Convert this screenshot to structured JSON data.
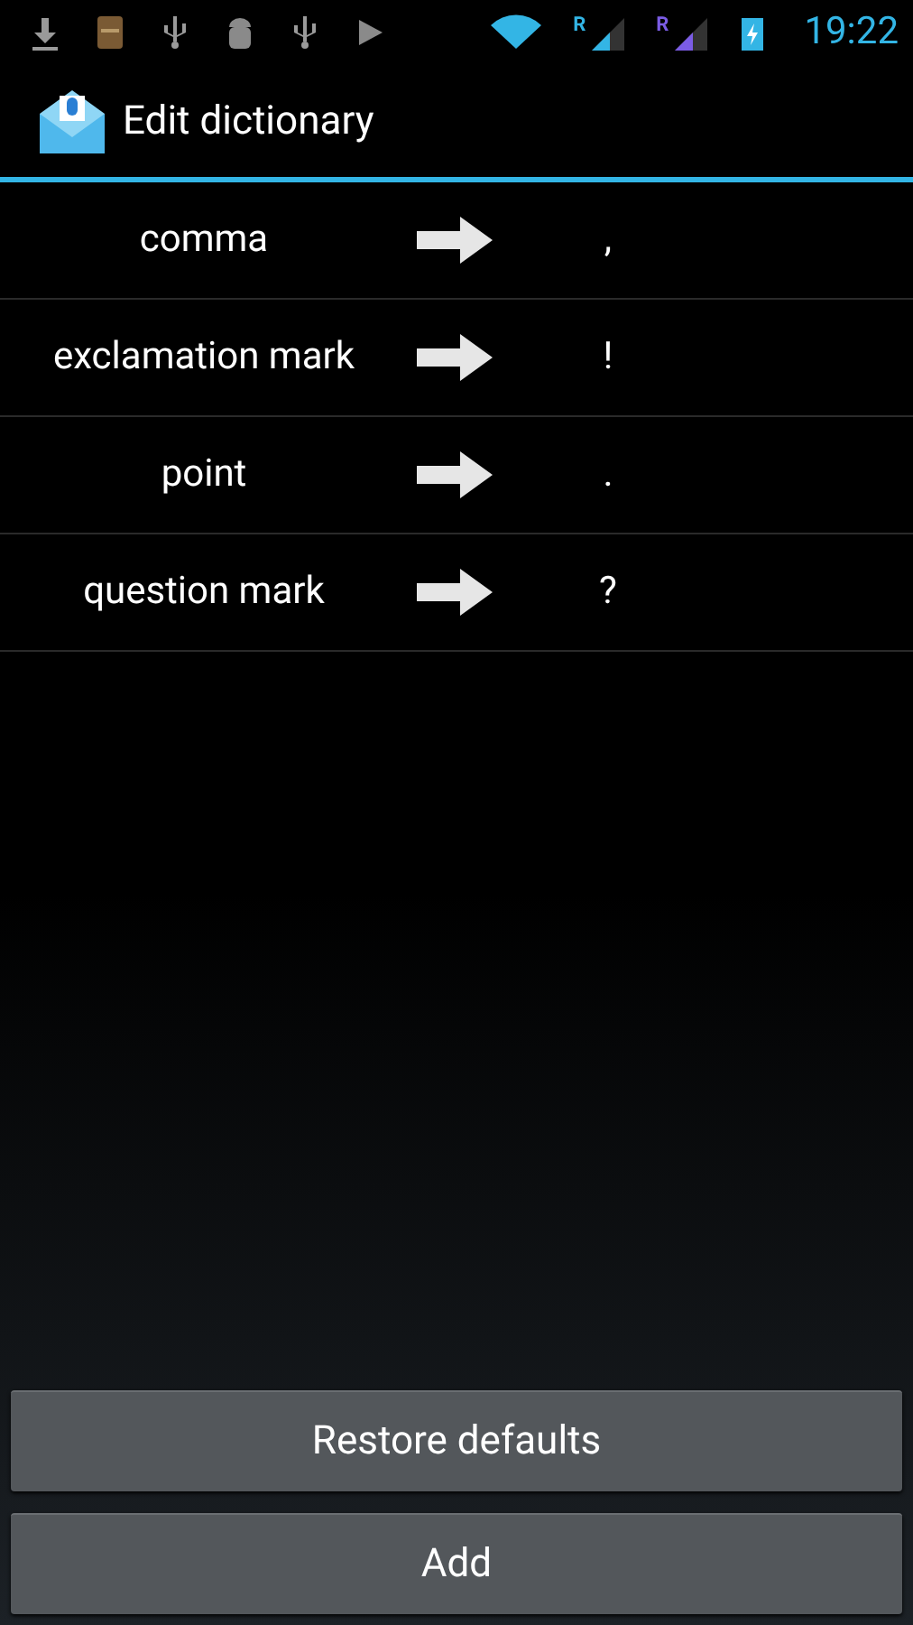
{
  "status_bar": {
    "roaming": [
      "R",
      "R"
    ],
    "time": "19:22"
  },
  "action_bar": {
    "title": "Edit dictionary"
  },
  "entries": [
    {
      "phrase": "comma",
      "replacement": ","
    },
    {
      "phrase": "exclamation mark",
      "replacement": "!"
    },
    {
      "phrase": "point",
      "replacement": "."
    },
    {
      "phrase": "question mark",
      "replacement": "?"
    }
  ],
  "buttons": [
    "Restore defaults",
    "Add"
  ]
}
